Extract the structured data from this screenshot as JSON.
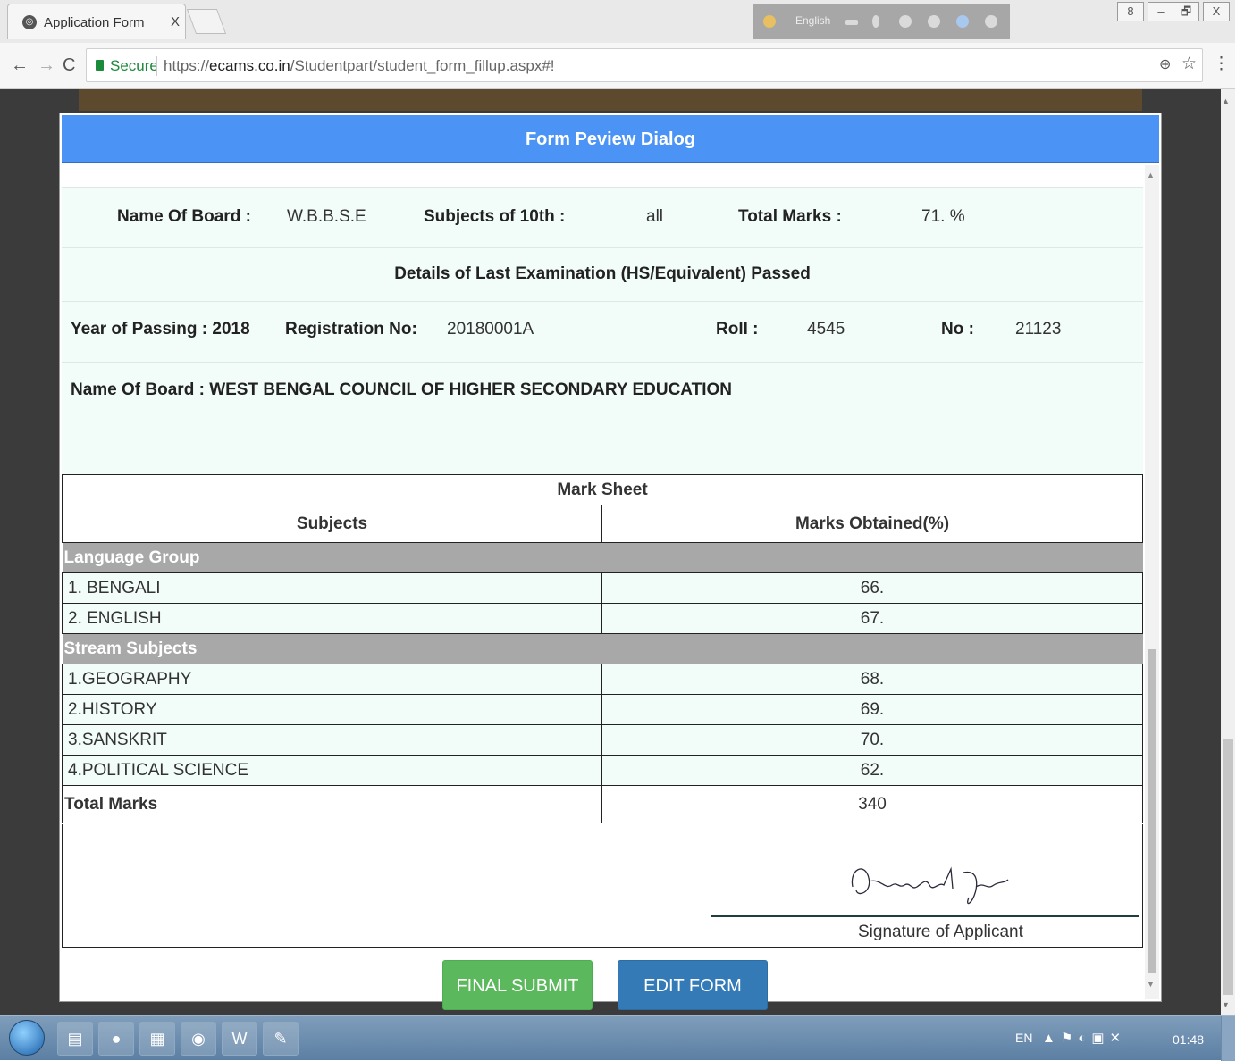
{
  "browser": {
    "tab_title": "Application Form",
    "tab_close": "X",
    "toolbar_language": "English",
    "window_controls": [
      "8",
      "–",
      "🗗",
      "X"
    ],
    "address": {
      "secure_label": "Secure",
      "url_scheme": "https://",
      "url_host": "ecams.co.in",
      "url_path": "/Studentpart/student_form_fillup.aspx#!"
    }
  },
  "dialog": {
    "title": "Form Peview Dialog",
    "tenth": {
      "board_label": "Name Of Board :",
      "board_value": "W.B.B.S.E",
      "subjects_label": "Subjects of 10th :",
      "subjects_value": "all",
      "total_label": "Total Marks :",
      "total_value": "71. %"
    },
    "last_exam": {
      "heading": "Details of Last Examination (HS/Equivalent) Passed",
      "year_label": "Year of Passing : 2018",
      "reg_label": "Registration No:",
      "reg_value": "20180001A",
      "roll_label": "Roll :",
      "roll_value": "4545",
      "no_label": "No :",
      "no_value": "21123",
      "board_line": "Name Of Board : WEST BENGAL COUNCIL OF HIGHER SECONDARY EDUCATION"
    },
    "marksheet": {
      "title": "Mark Sheet",
      "col_subjects": "Subjects",
      "col_marks": "Marks Obtained(%)",
      "groups": [
        {
          "name": "Language Group",
          "rows": [
            {
              "subject": "1. BENGALI",
              "mark": "66."
            },
            {
              "subject": "2. ENGLISH",
              "mark": "67."
            }
          ]
        },
        {
          "name": "Stream Subjects",
          "rows": [
            {
              "subject": "1.GEOGRAPHY",
              "mark": "68."
            },
            {
              "subject": "2.HISTORY",
              "mark": "69."
            },
            {
              "subject": "3.SANSKRIT",
              "mark": "70."
            },
            {
              "subject": "4.POLITICAL SCIENCE",
              "mark": "62."
            }
          ]
        }
      ],
      "total_label": "Total Marks",
      "total_value": "340"
    },
    "signature_label": "Signature of Applicant",
    "buttons": {
      "final_submit": "FINAL SUBMIT",
      "edit_form": "EDIT FORM"
    }
  },
  "taskbar": {
    "language": "EN",
    "clock": "01:48",
    "apps": [
      "file-explorer-icon",
      "firefox-icon",
      "calculator-icon",
      "chrome-icon",
      "word-icon",
      "paint-icon"
    ]
  },
  "colors": {
    "dialog_header": "#4b93f5",
    "group_row": "#a8a8a8",
    "row_bg": "#f2fcf8",
    "final_submit": "#5cb85c",
    "edit_form": "#337ab7"
  }
}
